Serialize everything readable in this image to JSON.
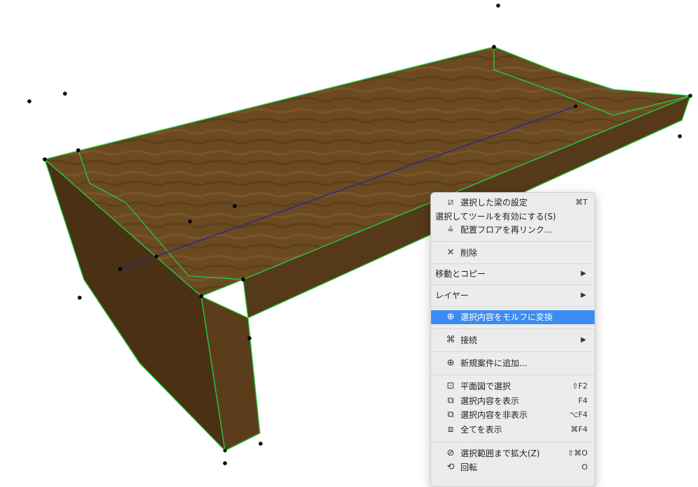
{
  "colors": {
    "highlight": "#3b8cf0",
    "edge": "#22cc44",
    "wood": "#6b4a22",
    "axis": "#2a2a8a"
  },
  "menu": {
    "items": [
      {
        "icon": "beam-settings-icon",
        "label": "選択した梁の設定",
        "shortcut": "⌘T"
      },
      {
        "label": "選択してツールを有効にする(S)"
      },
      {
        "icon": "relink-floor-icon",
        "label": "配置フロアを再リンク..."
      },
      {
        "icon": "delete-icon",
        "label": "削除"
      },
      {
        "label": "移動とコピー",
        "submenu": "▶"
      },
      {
        "label": "レイヤー",
        "submenu": "▶"
      },
      {
        "icon": "morph-convert-icon",
        "label": "選択内容をモルフに変換"
      },
      {
        "icon": "connect-icon",
        "label": "接続",
        "submenu": "▶"
      },
      {
        "icon": "add-issue-icon",
        "label": "新規案件に追加..."
      },
      {
        "icon": "select-in-plan-icon",
        "label": "平面図で選択",
        "shortcut": "⇧F2"
      },
      {
        "icon": "show-selection-icon",
        "label": "選択内容を表示",
        "shortcut": "F4"
      },
      {
        "icon": "hide-selection-icon",
        "label": "選択内容を非表示",
        "shortcut": "⌥F4"
      },
      {
        "icon": "show-all-icon",
        "label": "全てを表示",
        "shortcut": "⌘F4"
      },
      {
        "icon": "zoom-selection-icon",
        "label": "選択範囲まで拡大(Z)",
        "shortcut": "⇧⌘O"
      },
      {
        "icon": "orbit-icon",
        "label": "回転",
        "shortcut": "O"
      }
    ]
  }
}
